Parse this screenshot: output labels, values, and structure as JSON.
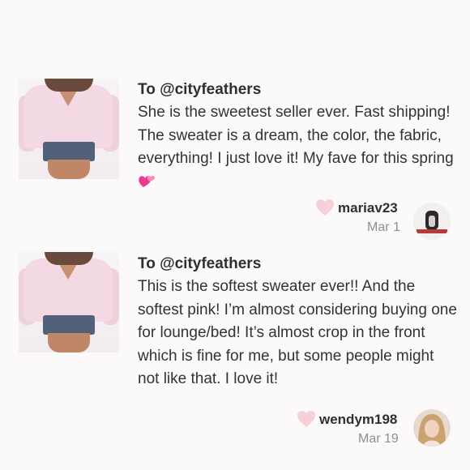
{
  "reviews": [
    {
      "recipient": "To @cityfeathers",
      "text": "She is the sweetest seller ever. Fast shipping! The sweater is a dream, the color, the fabric, everything! I just love it! My fave for this spring",
      "username": "mariav23",
      "date": "Mar 1",
      "icons": {
        "like": "heart-icon",
        "emoji": "two-hearts-emoji"
      }
    },
    {
      "recipient": "To @cityfeathers",
      "text": "This is the softest sweater ever!! And the softest pink! I’m almost considering buying one for lounge/bed! It’s almost crop in the front which is fine for me, but some people might not like that. I love it!",
      "username": "wendym198",
      "date": "Mar 19",
      "icons": {
        "like": "heart-icon"
      }
    }
  ],
  "colors": {
    "background": "#fbf9fa",
    "heart": "#f6cfd7",
    "emoji": "#e93b8f",
    "muted": "#8f8f8f"
  }
}
